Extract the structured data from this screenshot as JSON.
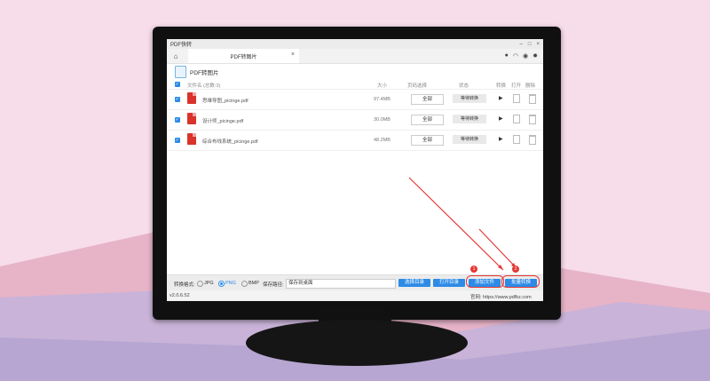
{
  "window": {
    "title": "PDF快转",
    "min": "–",
    "max": "□",
    "close": "×"
  },
  "tab": {
    "label": "PDF转图片",
    "close": "×"
  },
  "section_title": "PDF转图片",
  "table": {
    "headers": {
      "filename": "文件名 (总数:3)",
      "size": "大小",
      "page_select": "页码选择",
      "status": "状态",
      "convert": "转换",
      "open": "打开",
      "delete": "删除"
    },
    "rows": [
      {
        "name": "思维导图_picinge.pdf",
        "size": "97.4MB",
        "pages": "全部",
        "status": "等待转换"
      },
      {
        "name": "设计师_picinge.pdf",
        "size": "30.0MB",
        "pages": "全部",
        "status": "等待转换"
      },
      {
        "name": "综合布线系统_picinge.pdf",
        "size": "48.2MB",
        "pages": "全部",
        "status": "等待转换"
      }
    ]
  },
  "bottom": {
    "format_label": "转换格式:",
    "formats": [
      "JPG",
      "PNG",
      "BMP"
    ],
    "selected_format": "PNG",
    "path_label": "保存路径:",
    "path_value": "保存到桌面",
    "select_dir": "选择目录",
    "open_dir": "打开目录",
    "add_file": "添加文件",
    "batch_convert": "批量转换"
  },
  "statusbar": {
    "version": "v2.0.6.52",
    "site": "官网: https://www.pdfkz.com"
  },
  "annotations": {
    "badge1": "1",
    "badge2": "2"
  },
  "colors": {
    "accent": "#2d8be6",
    "pdf_red": "#d9332b",
    "annotation_red": "#e53935"
  }
}
